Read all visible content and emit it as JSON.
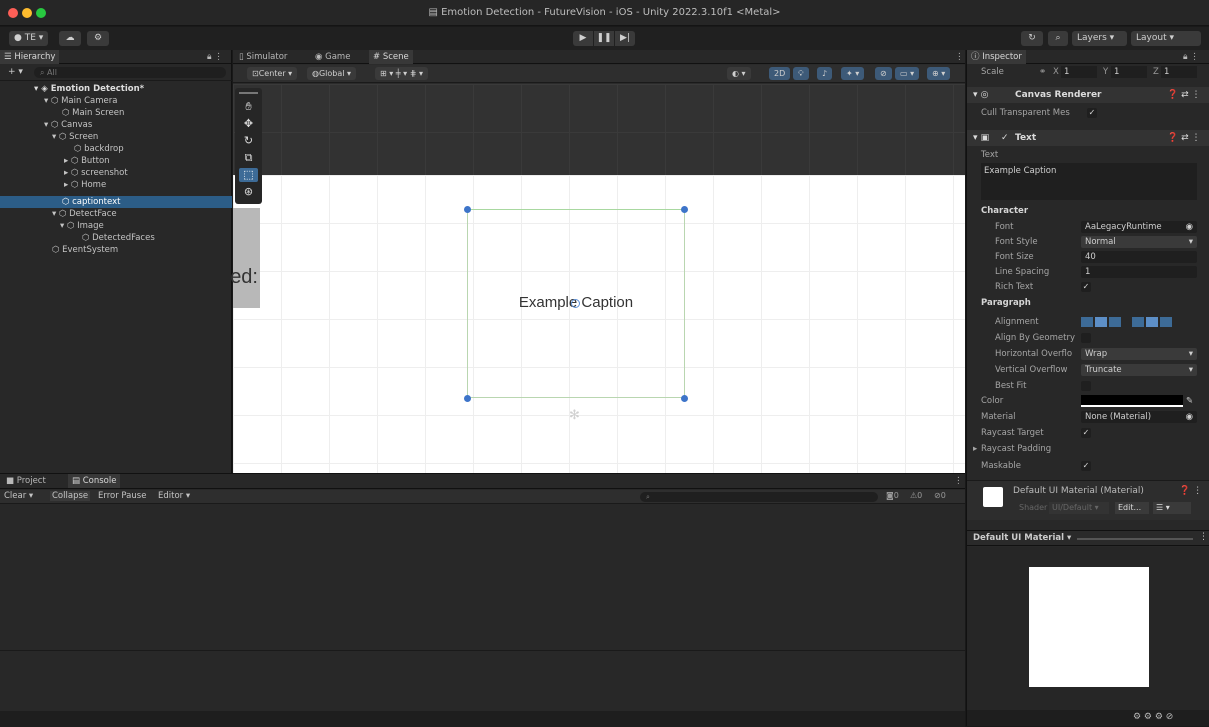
{
  "window": {
    "title": "Emotion Detection - FutureVision - iOS - Unity 2022.3.10f1 <Metal>"
  },
  "toolbar": {
    "account": "TE",
    "search_icon": "search-icon",
    "layers": "Layers",
    "layout": "Layout"
  },
  "hierarchy": {
    "tab": "Hierarchy",
    "search_placeholder": "All",
    "items": [
      {
        "label": "Emotion Detection*"
      },
      {
        "label": "Main Camera"
      },
      {
        "label": "Main Screen"
      },
      {
        "label": "Canvas"
      },
      {
        "label": "Screen"
      },
      {
        "label": "backdrop"
      },
      {
        "label": "Button"
      },
      {
        "label": "screenshot"
      },
      {
        "label": "Home"
      },
      {
        "label": "captiontext"
      },
      {
        "label": "DetectFace"
      },
      {
        "label": "Image"
      },
      {
        "label": "DetectedFaces"
      },
      {
        "label": "EventSystem"
      }
    ]
  },
  "scene": {
    "tabs": [
      "Simulator",
      "Game",
      "Scene"
    ],
    "pivot": "Center",
    "space": "Global",
    "mode_2d": "2D",
    "caption": "Example Caption",
    "partial_text": "ed:"
  },
  "inspector": {
    "tab": "Inspector",
    "scale_label": "Scale",
    "scale_x_label": "X",
    "scale_x": "1",
    "scale_y_label": "Y",
    "scale_y": "1",
    "scale_z_label": "Z",
    "scale_z": "1",
    "canvas_renderer": "Canvas Renderer",
    "cull_label": "Cull Transparent Mes",
    "text_component": "Text",
    "text_label": "Text",
    "text_value": "Example Caption",
    "character": "Character",
    "font_label": "Font",
    "font_value": "LegacyRuntime",
    "font_style_label": "Font Style",
    "font_style_value": "Normal",
    "font_size_label": "Font Size",
    "font_size_value": "40",
    "line_spacing_label": "Line Spacing",
    "line_spacing_value": "1",
    "rich_text_label": "Rich Text",
    "paragraph": "Paragraph",
    "alignment_label": "Alignment",
    "align_geom_label": "Align By Geometry",
    "horiz_label": "Horizontal Overflo",
    "horiz_value": "Wrap",
    "vert_label": "Vertical Overflow",
    "vert_value": "Truncate",
    "best_fit_label": "Best Fit",
    "color_label": "Color",
    "material_label": "Material",
    "material_value": "None (Material)",
    "raycast_label": "Raycast Target",
    "raycast_padding_label": "Raycast Padding",
    "maskable_label": "Maskable",
    "material_name": "Default UI Material (Material)",
    "shader_label": "Shader",
    "shader_value": "UI/Default",
    "edit_label": "Edit...",
    "preview_label": "Default UI Material"
  },
  "console": {
    "tabs": [
      "Project",
      "Console"
    ],
    "clear": "Clear",
    "collapse": "Collapse",
    "error_pause": "Error Pause",
    "editor": "Editor",
    "counts": [
      "0",
      "0",
      "0"
    ]
  }
}
